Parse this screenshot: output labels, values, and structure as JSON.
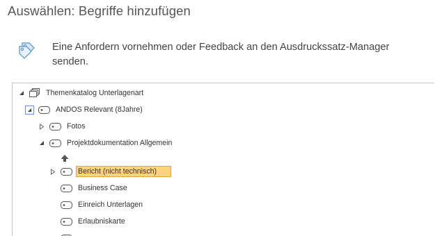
{
  "dialog": {
    "title": "Auswählen: Begriffe hinzufügen"
  },
  "info": {
    "icon": "tags-icon",
    "text": "Eine Anfordern vornehmen oder Feedback an den Ausdruckssatz-Manager senden."
  },
  "tree": {
    "root": {
      "label": "Themenkatalog Unterlagenart",
      "icon": "term-store-icon",
      "expanded": true
    },
    "nodes": [
      {
        "label": "ANDOS Relevant (8Jahre)",
        "expanded": true,
        "icon": "term-icon"
      },
      {
        "label": "Fotos",
        "expanded": false,
        "icon": "term-icon"
      },
      {
        "label": "Projektdokumentation Allgemein",
        "expanded": true,
        "icon": "term-icon"
      },
      {
        "label": "Bericht (nicht technisch)",
        "expanded": false,
        "selected": true,
        "icon": "term-icon"
      },
      {
        "label": "Business Case",
        "icon": "term-icon"
      },
      {
        "label": "Einreich Unterlagen",
        "icon": "term-icon"
      },
      {
        "label": "Erlaubniskarte",
        "icon": "term-icon"
      }
    ],
    "move_up_icon": "arrow-up-icon",
    "colors": {
      "selected_bg": "#fdd47d",
      "selected_border": "#e9a531",
      "focus_border": "#6b8fd6"
    }
  }
}
